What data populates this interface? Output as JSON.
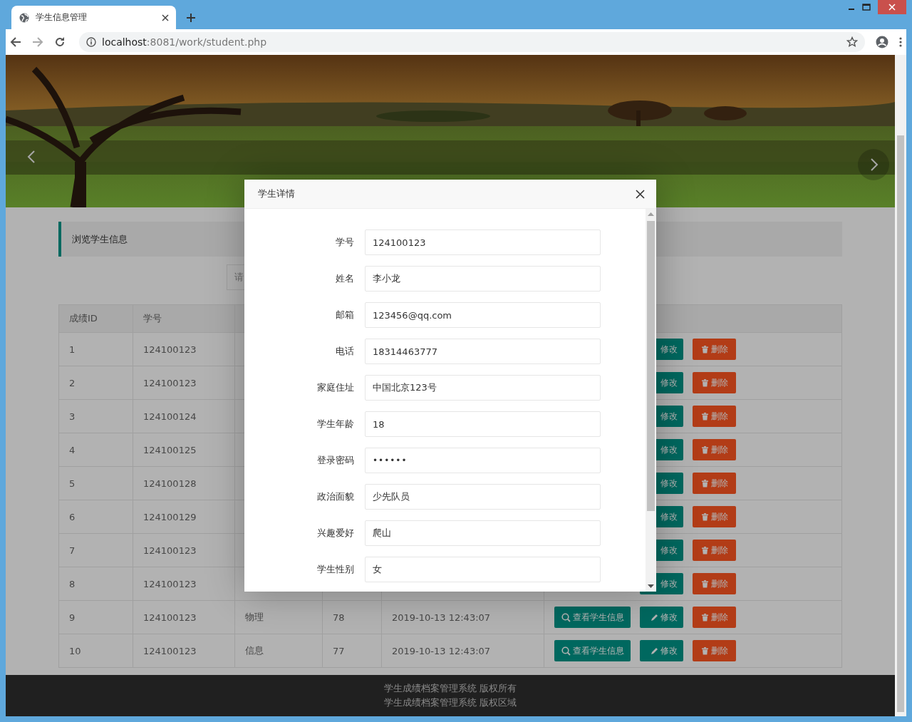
{
  "browser": {
    "tab_title": "学生信息管理",
    "url_host": "localhost",
    "url_path": ":8081/work/student.php"
  },
  "panel_title": "浏览学生信息",
  "search": {
    "placeholder": "请"
  },
  "table": {
    "columns": [
      "成绩ID",
      "学号"
    ],
    "rows": [
      {
        "id": "1",
        "student_no": "124100123",
        "actions": [
          {
            "kind": "edit",
            "label": "修改",
            "show_icon": false
          },
          {
            "kind": "delete",
            "label": "删除"
          }
        ]
      },
      {
        "id": "2",
        "student_no": "124100123",
        "actions": [
          {
            "kind": "edit",
            "label": "修改",
            "show_icon": false
          },
          {
            "kind": "delete",
            "label": "删除"
          }
        ]
      },
      {
        "id": "3",
        "student_no": "124100124",
        "actions": [
          {
            "kind": "edit",
            "label": "修改",
            "show_icon": false
          },
          {
            "kind": "delete",
            "label": "删除"
          }
        ]
      },
      {
        "id": "4",
        "student_no": "124100125",
        "actions": [
          {
            "kind": "edit",
            "label": "修改",
            "show_icon": false
          },
          {
            "kind": "delete",
            "label": "删除"
          }
        ]
      },
      {
        "id": "5",
        "student_no": "124100128",
        "actions": [
          {
            "kind": "edit",
            "label": "修改",
            "show_icon": false
          },
          {
            "kind": "delete",
            "label": "删除"
          }
        ]
      },
      {
        "id": "6",
        "student_no": "124100129",
        "actions": [
          {
            "kind": "edit",
            "label": "修改",
            "show_icon": false
          },
          {
            "kind": "delete",
            "label": "删除"
          }
        ]
      },
      {
        "id": "7",
        "student_no": "124100123",
        "actions": [
          {
            "kind": "edit",
            "label": "修改",
            "show_icon": false
          },
          {
            "kind": "delete",
            "label": "删除"
          }
        ]
      },
      {
        "id": "8",
        "student_no": "124100123",
        "actions": [
          {
            "kind": "edit",
            "label": "修改",
            "show_icon": false
          },
          {
            "kind": "delete",
            "label": "删除"
          }
        ]
      },
      {
        "id": "9",
        "student_no": "124100123",
        "course": "物理",
        "score": "78",
        "time": "2019-10-13 12:43:07",
        "actions": [
          {
            "kind": "view",
            "label": "查看学生信息"
          },
          {
            "kind": "edit",
            "label": "修改",
            "show_icon": true
          },
          {
            "kind": "delete",
            "label": "删除"
          }
        ]
      },
      {
        "id": "10",
        "student_no": "124100123",
        "course": "信息",
        "score": "77",
        "time": "2019-10-13 12:43:07",
        "actions": [
          {
            "kind": "view",
            "label": "查看学生信息"
          },
          {
            "kind": "edit",
            "label": "修改",
            "show_icon": true
          },
          {
            "kind": "delete",
            "label": "删除"
          }
        ]
      }
    ]
  },
  "footer": [
    "学生成绩档案管理系统 版权所有",
    "学生成绩档案管理系统 版权区域"
  ],
  "modal": {
    "title": "学生详情",
    "fields": [
      {
        "label": "学号",
        "value": "124100123",
        "kind": "text"
      },
      {
        "label": "姓名",
        "value": "李小龙",
        "kind": "text"
      },
      {
        "label": "邮箱",
        "value": "123456@qq.com",
        "kind": "text"
      },
      {
        "label": "电话",
        "value": "18314463777",
        "kind": "text"
      },
      {
        "label": "家庭住址",
        "value": "中国北京123号",
        "kind": "text"
      },
      {
        "label": "学生年龄",
        "value": "18",
        "kind": "text"
      },
      {
        "label": "登录密码",
        "value": "••••••",
        "kind": "password"
      },
      {
        "label": "政治面貌",
        "value": "少先队员",
        "kind": "text"
      },
      {
        "label": "兴趣爱好",
        "value": "爬山",
        "kind": "text"
      },
      {
        "label": "学生性别",
        "value": "女",
        "kind": "text"
      }
    ]
  }
}
